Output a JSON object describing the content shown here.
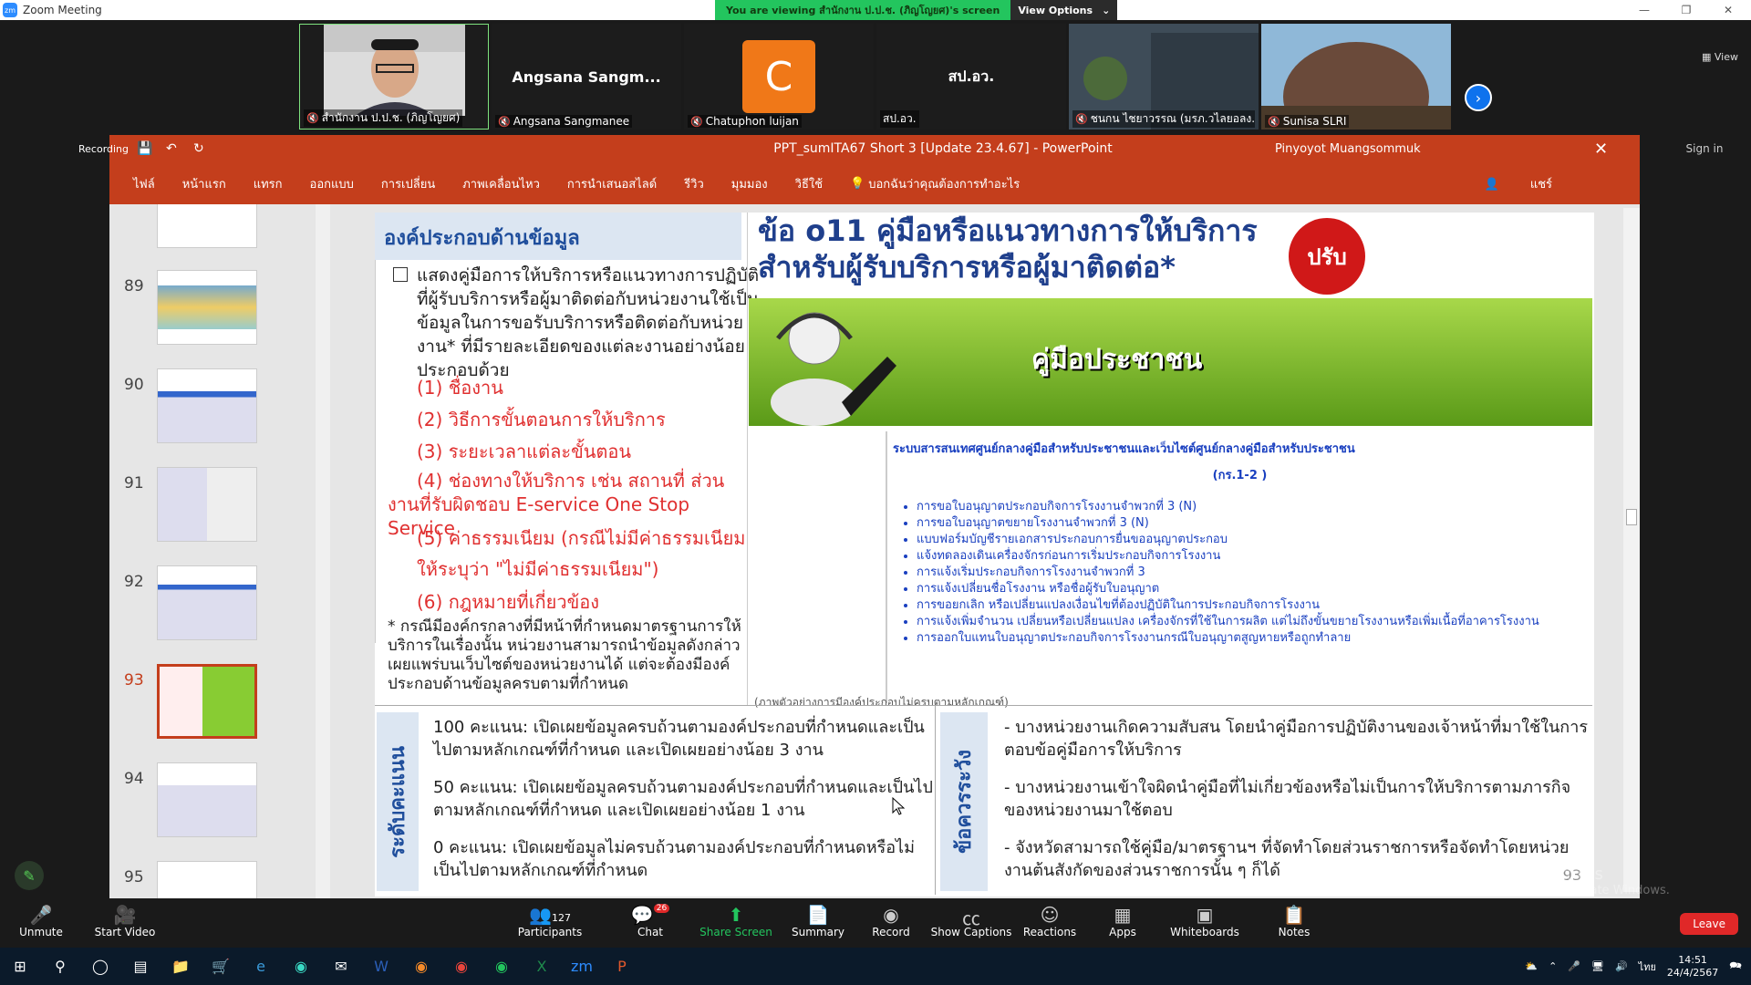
{
  "window": {
    "title": "Zoom Meeting"
  },
  "banner": {
    "viewing": "You are viewing สำนักงาน ป.ป.ช. (ภิญโญยศ)'s screen",
    "options": "View Options"
  },
  "strip": {
    "view_label": "View",
    "participants": [
      {
        "name": "สำนักงาน ป.ป.ช. (ภิญโญยศ)",
        "big": ""
      },
      {
        "name": "Angsana Sangmanee",
        "big": "Angsana Sangm..."
      },
      {
        "name": "Chatuphon luijan",
        "big": "C"
      },
      {
        "name": "สป.อว.",
        "big": "สป.อว."
      },
      {
        "name": "ชนกน ไชยาวรรณ (มรภ.วไลยอลง...",
        "big": ""
      },
      {
        "name": "Sunisa SLRI",
        "big": ""
      }
    ]
  },
  "ppt": {
    "recording": "Recording",
    "title": "PPT_sumITA67 Short 3 [Update 23.4.67] - PowerPoint",
    "user": "Pinyoyot Muangsommuk",
    "signin": "Sign in",
    "share": "แชร์",
    "tell": "บอกฉันว่าคุณต้องการทำอะไร",
    "menu": [
      "ไฟล์",
      "หน้าแรก",
      "แทรก",
      "ออกแบบ",
      "การเปลี่ยน",
      "ภาพเคลื่อนไหว",
      "การนำเสนอสไลด์",
      "รีวิว",
      "มุมมอง",
      "วิธีใช้"
    ],
    "thumbs": [
      {
        "num": "89"
      },
      {
        "num": "90"
      },
      {
        "num": "91"
      },
      {
        "num": "92"
      },
      {
        "num": "93",
        "selected": true
      },
      {
        "num": "94"
      },
      {
        "num": "95"
      }
    ]
  },
  "slide": {
    "left_header": "องค์ประกอบด้านข้อมูล",
    "intro": "แสดงคู่มือการให้บริการหรือแนวทางการปฏิบัติที่ผู้รับบริการหรือผู้มาติดต่อกับหน่วยงานใช้เป็นข้อมูลในการขอรับบริการหรือติดต่อกับหน่วยงาน* ที่มีรายละเอียดของแต่ละงานอย่างน้อยประกอบด้วย",
    "items": [
      "(1) ชื่องาน",
      "(2) วิธีการขั้นตอนการให้บริการ",
      "(3) ระยะเวลาแต่ละขั้นตอน",
      "(4) ช่องทางให้บริการ เช่น สถานที่ ส่วนงานที่รับผิดชอบ E-service One Stop Service",
      "(5) ค่าธรรมเนียม (กรณีไม่มีค่าธรรมเนียม ให้ระบุว่า \"ไม่มีค่าธรรมเนียม\")",
      "(6) กฎหมายที่เกี่ยวข้อง"
    ],
    "footnote": "* กรณีมีองค์กรกลางที่มีหน้าที่กำหนดมาตรฐานการให้บริการในเรื่องนั้น หน่วยงานสามารถนำข้อมูลดังกล่าวเผยแพร่บนเว็บไซต์ของหน่วยงานได้ แต่จะต้องมีองค์ประกอบด้านข้อมูลครบตามที่กำหนด",
    "right_title_1": "ข้อ o11 คู่มือหรือแนวทางการให้บริการ",
    "right_title_2": "สำหรับผู้รับบริการหรือผู้มาติดต่อ*",
    "badge": "ปรับ",
    "banner_text": "คู่มือประชาชน",
    "doc_header": "ระบบสารสนเทศศูนย์กลางคู่มือสำหรับประชาชนและเว็บไซต์ศูนย์กลางคู่มือสำหรับประชาชน",
    "doc_sub": "(กร.1-2 )",
    "doc_list": [
      "การขอใบอนุญาตประกอบกิจการโรงงานจำพวกที่ 3 (N)",
      "การขอใบอนุญาตขยายโรงงานจำพวกที่ 3 (N)",
      "แบบฟอร์มบัญชีรายเอกสารประกอบการยื่นขออนุญาตประกอบ",
      "แจ้งทดลองเดินเครื่องจักรก่อนการเริ่มประกอบกิจการโรงงาน",
      "การแจ้งเริ่มประกอบกิจการโรงงานจำพวกที่ 3",
      "การแจ้งเปลี่ยนชื่อโรงงาน หรือชื่อผู้รับใบอนุญาต",
      "การขอยกเลิก หรือเปลี่ยนแปลงเงื่อนไขที่ต้องปฏิบัติในการประกอบกิจการโรงงาน",
      "การแจ้งเพิ่มจำนวน เปลี่ยนหรือเปลี่ยนแปลง เครื่องจักรที่ใช้ในการผลิต แต่ไม่ถึงขั้นขยายโรงงานหรือเพิ่มเนื้อที่อาคารโรงงาน",
      "การออกใบแทนใบอนุญาตประกอบกิจการโรงงานกรณีใบอนุญาตสูญหายหรือถูกทำลาย"
    ],
    "caption": "(ภาพตัวอย่างการมีองค์ประกอบไม่ครบตามหลักเกณฑ์)",
    "score_label": "ระดับคะแนน",
    "scores": [
      "100 คะแนน: เปิดเผยข้อมูลครบถ้วนตามองค์ประกอบที่กำหนดและเป็นไปตามหลักเกณฑ์ที่กำหนด และเปิดเผยอย่างน้อย 3 งาน",
      "50 คะแนน: เปิดเผยข้อมูลครบถ้วนตามองค์ประกอบที่กำหนดและเป็นไปตามหลักเกณฑ์ที่กำหนด และเปิดเผยอย่างน้อย 1 งาน",
      "0 คะแนน: เปิดเผยข้อมูลไม่ครบถ้วนตามองค์ประกอบที่กำหนดหรือไม่เป็นไปตามหลักเกณฑ์ที่กำหนด"
    ],
    "caution_label": "ข้อควรระวัง",
    "cautions": [
      "- บางหน่วยงานเกิดความสับสน โดยนำคู่มือการปฏิบัติงานของเจ้าหน้าที่มาใช้ในการตอบข้อคู่มือการให้บริการ",
      "- บางหน่วยงานเข้าใจผิดนำคู่มือที่ไม่เกี่ยวข้องหรือไม่เป็นการให้บริการตามภารกิจของหน่วยงานมาใช้ตอบ",
      "- จังหวัดสามารถใช้คู่มือ/มาตรฐานฯ ที่จัดทำโดยส่วนราชการหรือจัดทำโดยหน่วยงานต้นสังกัดของส่วนราชการนั้น ๆ ก็ได้"
    ],
    "page_num": "93"
  },
  "activate": {
    "l1": "Activate Windows",
    "l2": "Go to Settings to activate Windows."
  },
  "toolbar": {
    "participants_count": "127",
    "chat_badge": "26",
    "items": [
      "Unmute",
      "Start Video",
      "Participants",
      "Chat",
      "Share Screen",
      "Summary",
      "Record",
      "Show Captions",
      "Reactions",
      "Apps",
      "Whiteboards",
      "Notes"
    ],
    "leave": "Leave"
  },
  "taskbar": {
    "time": "14:51",
    "date": "24/4/2567",
    "lang": "ไทย"
  }
}
